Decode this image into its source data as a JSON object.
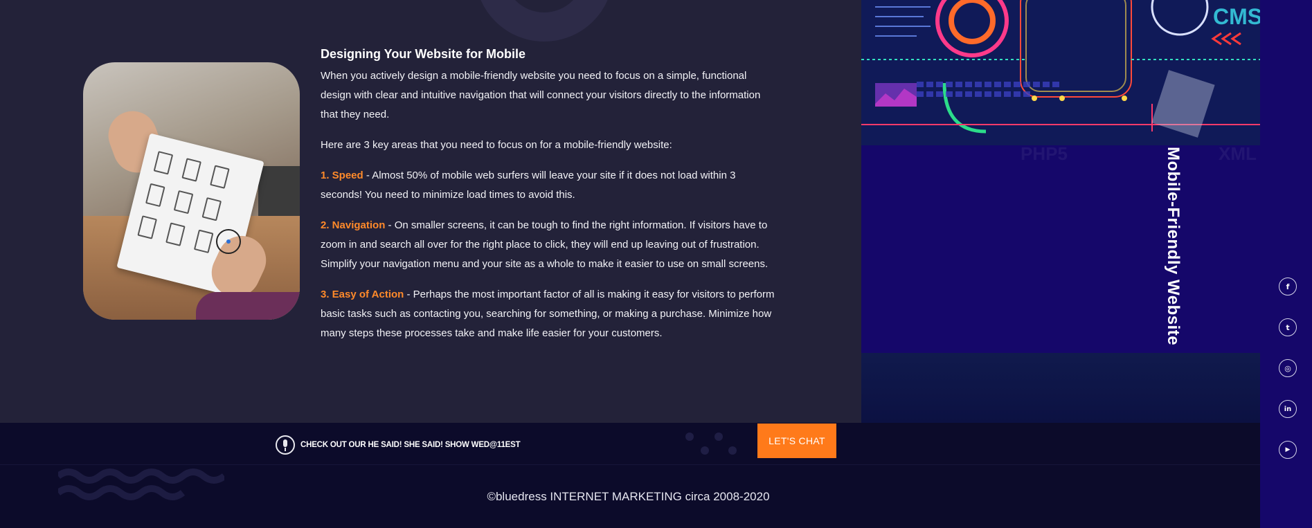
{
  "article": {
    "title": "Designing Your Website for Mobile",
    "intro": "When you actively design a mobile-friendly website you need to focus on a simple, functional design with clear and intuitive navigation that will connect your visitors directly to the information that they need.",
    "lead": "Here are 3 key areas that you need to focus on for a mobile-friendly website:",
    "points": [
      {
        "label": "1. Speed",
        "text": " - Almost 50% of mobile web surfers will leave your site if it does not load within 3 seconds! You need to minimize load times to avoid this."
      },
      {
        "label": "2. Navigation",
        "text": " - On smaller screens, it can be tough to find the right information. If visitors have to zoom in and search all over for the right place to click, they will end up leaving out of frustration. Simplify your navigation menu and your site as a whole to make it easier to use on small screens."
      },
      {
        "label": "3. Easy of Action",
        "text": " - Perhaps the most important factor of all is making it easy for visitors to perform basic tasks such as contacting you, searching for something, or making a purchase. Minimize how many steps these processes take and make life easier for your customers."
      }
    ]
  },
  "banner": {
    "vertical_title": "Mobile-Friendly Website",
    "circuit_label": "CMS",
    "ghost_labels": [
      "PHP5",
      "XML"
    ]
  },
  "social": {
    "icons": [
      {
        "name": "facebook-icon",
        "glyph": "f"
      },
      {
        "name": "twitter-icon",
        "glyph": "t"
      },
      {
        "name": "instagram-icon",
        "glyph": "◎"
      },
      {
        "name": "linkedin-icon",
        "glyph": "in"
      },
      {
        "name": "youtube-icon",
        "glyph": "▶"
      }
    ]
  },
  "footer": {
    "podcast_text": "CHECK OUT OUR HE SAID! SHE SAID! SHOW WED@11EST",
    "chat_button": "LET'S CHAT",
    "copyright": "©bluedress INTERNET MARKETING circa 2008-2020"
  },
  "colors": {
    "background": "#232239",
    "accent": "#ff7a1a",
    "highlight": "#ff8a2a",
    "panel": "#15076a",
    "footer": "#0c0b2a"
  }
}
